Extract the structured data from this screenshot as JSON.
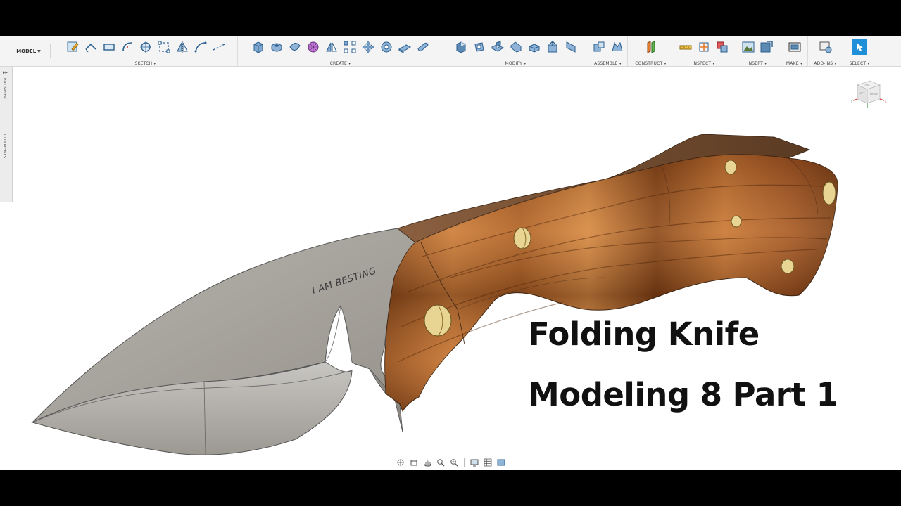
{
  "toolbar": {
    "mode": "MODEL",
    "groups": [
      {
        "label": "SKETCH",
        "icons": [
          "create-sketch-icon",
          "line-icon",
          "rectangle-icon",
          "arc-icon",
          "circle-icon",
          "trim-icon",
          "mirror-icon",
          "spline-icon",
          "construction-line-icon"
        ]
      },
      {
        "label": "CREATE",
        "icons": [
          "box-icon",
          "hole-icon",
          "loft-icon",
          "sphere-form-icon",
          "mirror-body-icon",
          "pattern-icon",
          "move-icon",
          "torus-icon",
          "extrude-icon",
          "cylinder-icon"
        ]
      },
      {
        "label": "MODIFY",
        "icons": [
          "press-pull-icon",
          "fillet-icon",
          "shell-icon",
          "chamfer-icon",
          "split-face-icon",
          "align-icon",
          "scale-icon"
        ]
      },
      {
        "label": "ASSEMBLE",
        "icons": [
          "new-component-icon",
          "joint-icon"
        ]
      },
      {
        "label": "CONSTRUCT",
        "icons": [
          "offset-plane-icon"
        ]
      },
      {
        "label": "INSPECT",
        "icons": [
          "measure-icon",
          "section-icon",
          "interference-icon"
        ]
      },
      {
        "label": "INSERT",
        "icons": [
          "insert-image-icon",
          "insert-mesh-icon"
        ]
      },
      {
        "label": "MAKE",
        "icons": [
          "print-3d-icon"
        ]
      },
      {
        "label": "ADD-INS",
        "icons": [
          "scripts-icon"
        ]
      },
      {
        "label": "SELECT",
        "icons": [
          "select-arrow-icon"
        ]
      }
    ]
  },
  "side_panel": {
    "browser": "BROWSER",
    "comments": "COMMENTS"
  },
  "viewcube": {
    "top": "TOP",
    "left": "LEFT",
    "front": "FRONT"
  },
  "engraving": "I AM BESTING",
  "overlay": {
    "line1": "Folding Knife",
    "line2": "Modeling 8 Part 1"
  },
  "colors": {
    "blade": "#a8a49f",
    "handle": "#a0522d",
    "pin": "#e6d38c",
    "select_accent": "#1e8fd8"
  }
}
